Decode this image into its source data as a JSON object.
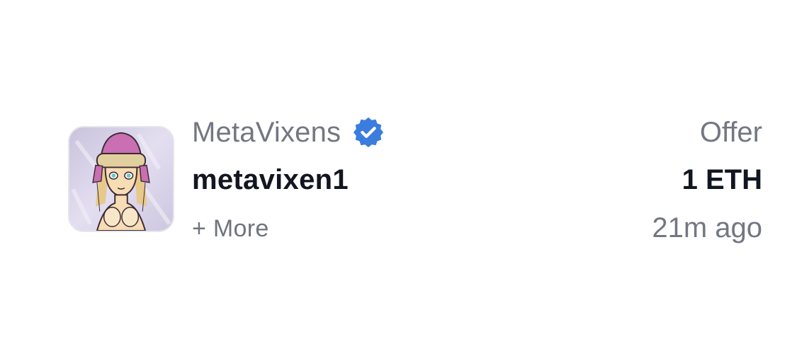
{
  "activity": {
    "collection_name": "MetaVixens",
    "verified_icon": "verified-badge-icon",
    "token_name": "metavixen1",
    "more_label": "+ More",
    "event_type": "Offer",
    "price": "1 ETH",
    "time_ago": "21m ago"
  },
  "colors": {
    "verified_badge": "#3a7ddf",
    "primary_text": "#121620",
    "secondary_text": "#737782"
  }
}
